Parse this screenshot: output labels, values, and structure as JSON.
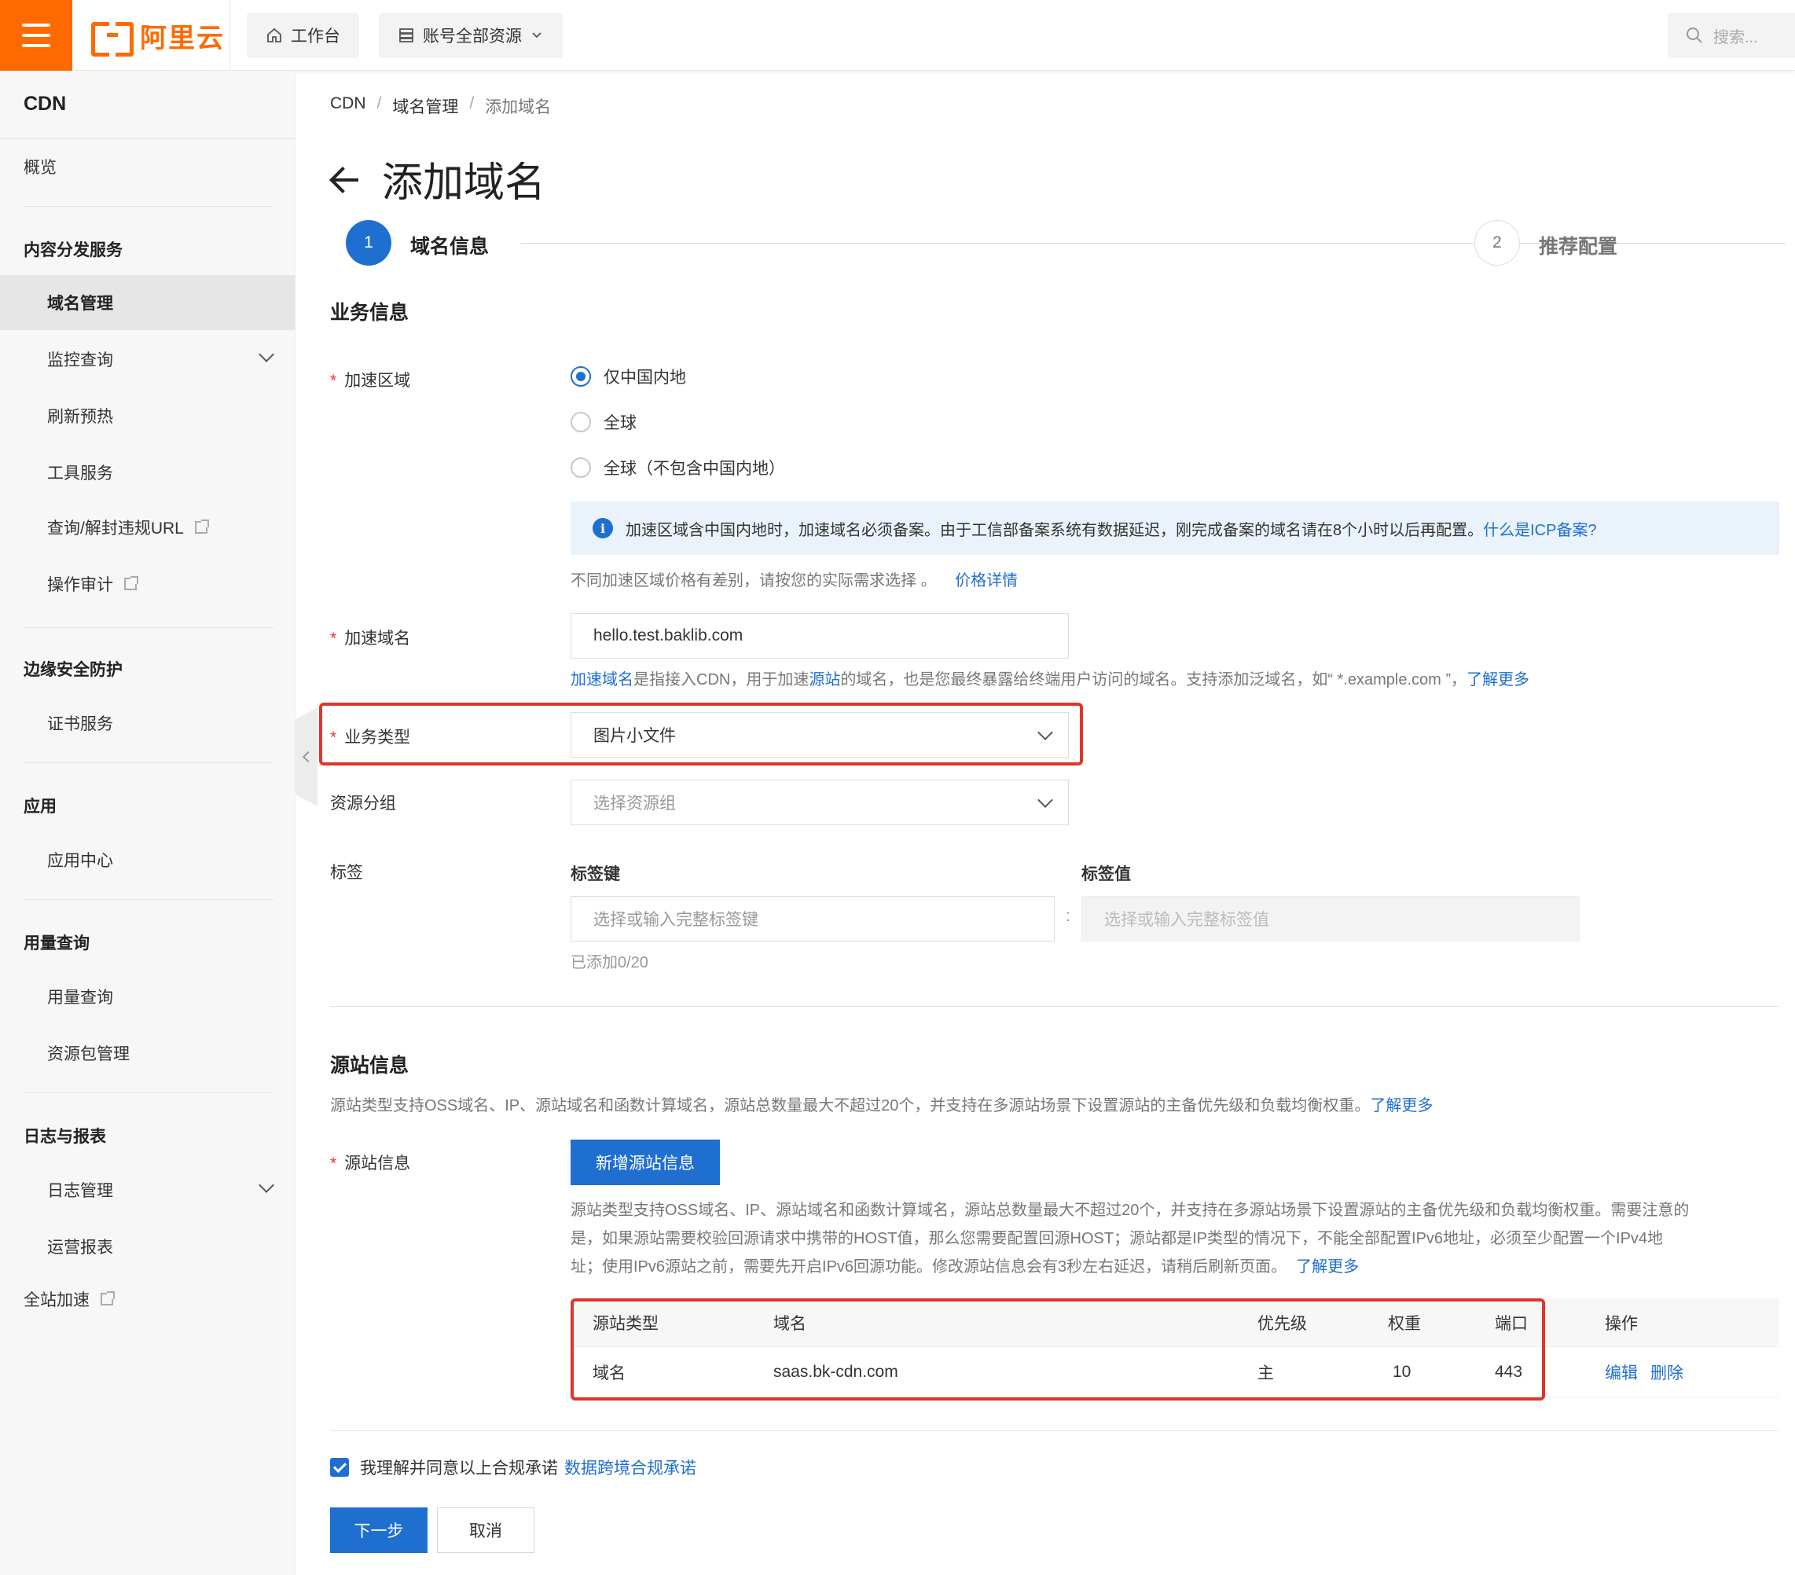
{
  "topbar": {
    "logo_text": "阿里云",
    "workbench": "工作台",
    "resources": "账号全部资源",
    "search_placeholder": "搜索...",
    "brand_color": "#ff6a00"
  },
  "sidebar": {
    "title": "CDN",
    "overview": "概览",
    "group_content": "内容分发服务",
    "domain_mgmt": "域名管理",
    "monitor": "监控查询",
    "refresh": "刷新预热",
    "tools": "工具服务",
    "url_query": "查询/解封违规URL",
    "audit": "操作审计",
    "group_security": "边缘安全防护",
    "cert": "证书服务",
    "group_app": "应用",
    "app_center": "应用中心",
    "group_usage": "用量查询",
    "usage_query": "用量查询",
    "package_mgmt": "资源包管理",
    "group_logs": "日志与报表",
    "log_mgmt": "日志管理",
    "ops_report": "运营报表",
    "dcdn": "全站加速"
  },
  "breadcrumb": {
    "items": [
      "CDN",
      "域名管理",
      "添加域名"
    ],
    "separator": "/"
  },
  "page": {
    "title": "添加域名"
  },
  "steps": {
    "step1_num": "1",
    "step1_label": "域名信息",
    "step2_num": "2",
    "step2_label": "推荐配置"
  },
  "business": {
    "section_title": "业务信息",
    "region_label": "加速区域",
    "region_options": [
      "仅中国内地",
      "全球",
      "全球（不包含中国内地）"
    ],
    "region_selected": "仅中国内地",
    "info_text": "加速区域含中国内地时，加速域名必须备案。由于工信部备案系统有数据延迟，刚完成备案的域名请在8个小时以后再配置。",
    "info_link": "什么是ICP备案?",
    "price_hint": "不同加速区域价格有差别，请按您的实际需求选择 。",
    "price_link": "价格详情",
    "domain_label": "加速域名",
    "domain_value": "hello.test.baklib.com",
    "domain_hint_link1": "加速域名",
    "domain_hint_text1": "是指接入CDN，用于加速",
    "domain_hint_link2": "源站",
    "domain_hint_text2": "的域名，也是您最终暴露给终端用户访问的域名。支持添加泛域名，如“ *.example.com ”，",
    "domain_hint_link3": "了解更多",
    "type_label": "业务类型",
    "type_value": "图片小文件",
    "group_label": "资源分组",
    "group_placeholder": "选择资源组",
    "tag_label": "标签",
    "tag_key_label": "标签键",
    "tag_value_label": "标签值",
    "tag_key_placeholder": "选择或输入完整标签键",
    "tag_value_placeholder": "选择或输入完整标签值",
    "tag_colon": ":",
    "tag_count": "已添加0/20"
  },
  "origin": {
    "section_title": "源站信息",
    "section_desc": "源站类型支持OSS域名、IP、源站域名和函数计算域名，源站总数量最大不超过20个，并支持在多源站场景下设置源站的主备优先级和负载均衡权重。",
    "section_desc_link": "了解更多",
    "label": "源站信息",
    "add_button": "新增源站信息",
    "para_line1": "源站类型支持OSS域名、IP、源站域名和函数计算域名，源站总数量最大不超过20个，并支持在多源站场景下设置源站的主备优先级和负载均衡权重。需要注意的",
    "para_line2": "是，如果源站需要校验回源请求中携带的HOST值，那么您需要配置回源HOST；源站都是IP类型的情况下，不能全部配置IPv6地址，必须至少配置一个IPv4地",
    "para_line3": "址；使用IPv6源站之前，需要先开启IPv6回源功能。修改源站信息会有3秒左右延迟，请稍后刷新页面。",
    "para_link": "了解更多",
    "table": {
      "headers": [
        "源站类型",
        "域名",
        "优先级",
        "权重",
        "端口",
        "操作"
      ],
      "rows": [
        {
          "type": "域名",
          "domain": "saas.bk-cdn.com",
          "priority": "主",
          "weight": "10",
          "port": "443",
          "edit": "编辑",
          "delete": "删除"
        }
      ]
    }
  },
  "footer": {
    "agree_text": "我理解并同意以上合规承诺",
    "agree_link": "数据跨境合规承诺",
    "next_button": "下一步",
    "cancel_button": "取消"
  }
}
